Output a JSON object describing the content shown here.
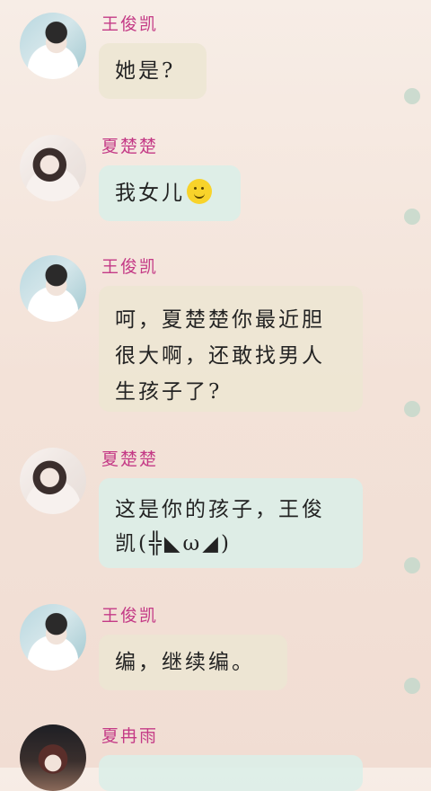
{
  "messages": [
    {
      "sender": "王俊凯",
      "text": "她是?",
      "avatar": "boy-avatar"
    },
    {
      "sender": "夏楚楚",
      "text": "我女儿",
      "emoji": "smiley-emoji",
      "avatar": "girl-avatar"
    },
    {
      "sender": "王俊凯",
      "text": "呵，夏楚楚你最近胆很大啊，还敢找男人生孩子了?",
      "avatar": "boy-avatar"
    },
    {
      "sender": "夏楚楚",
      "text": "这是你的孩子，王俊凯(╬◣ω◢)",
      "avatar": "girl-avatar"
    },
    {
      "sender": "王俊凯",
      "text": "编，继续编。",
      "avatar": "boy-avatar"
    },
    {
      "sender": "夏冉雨",
      "text": "",
      "avatar": "girl2-avatar"
    }
  ],
  "colors": {
    "name": "#c43a86",
    "bubble_beige": "#ece6d2",
    "bubble_mint": "#dceee8",
    "status_dot": "#c4d8cb"
  }
}
